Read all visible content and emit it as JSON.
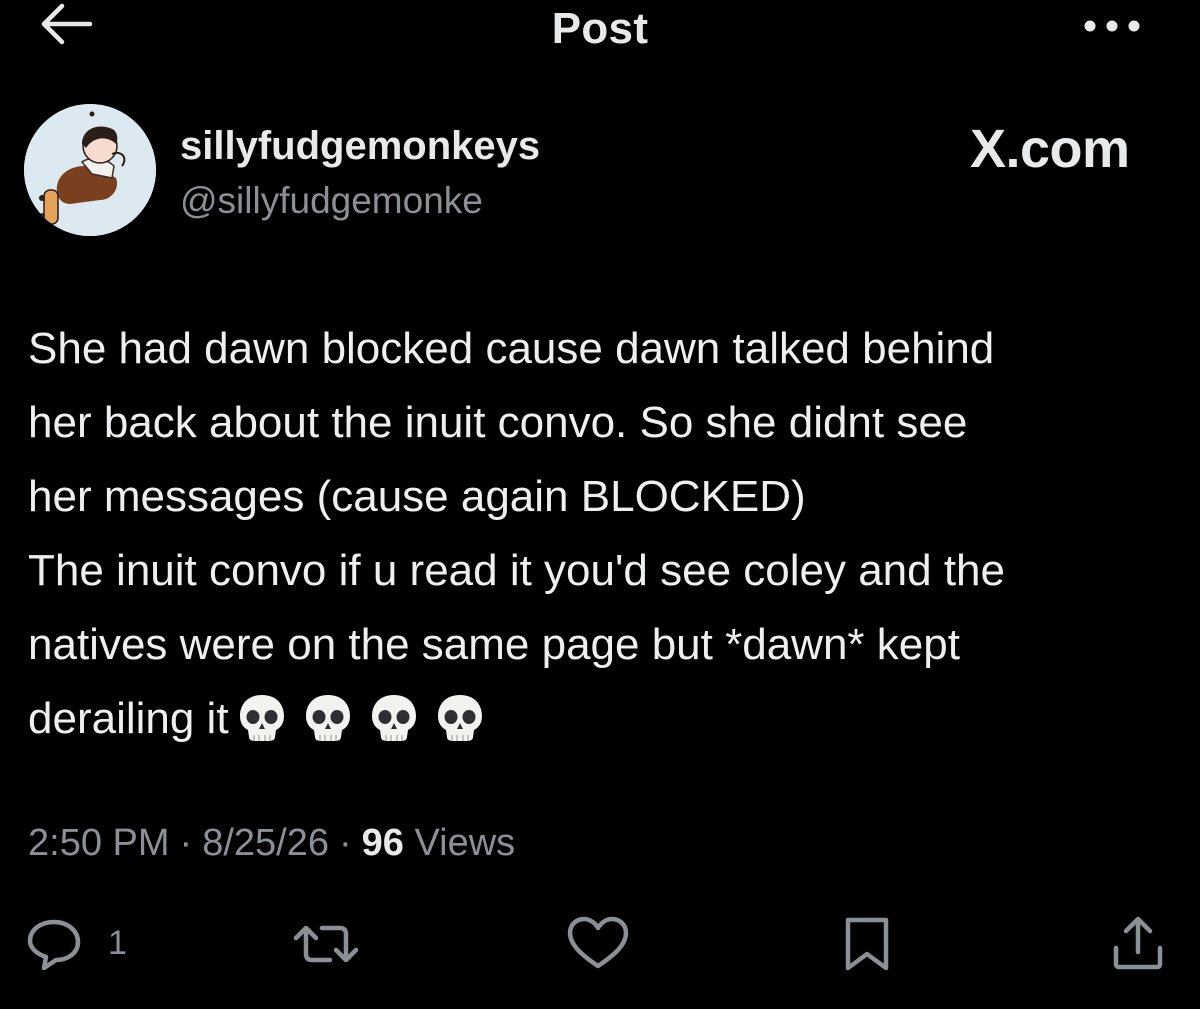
{
  "header": {
    "title": "Post",
    "back_icon": "arrow-left-icon",
    "more_icon": "more-horizontal-icon"
  },
  "author": {
    "display_name": "sillyfudgemonkeys",
    "handle": "@sillyfudgemonke",
    "avatar_icon": "cartoon-character-avatar"
  },
  "watermark": "X.com",
  "post": {
    "lines": [
      "She had dawn blocked cause dawn talked behind",
      "her back about the inuit convo. So she didnt see",
      "her messages (cause again BLOCKED)",
      "The inuit convo if u read it you'd see coley and the",
      "natives were on the same page but *dawn* kept",
      "derailing it"
    ],
    "emoji": [
      "skull-emoji",
      "skull-emoji",
      "skull-emoji",
      "skull-emoji"
    ]
  },
  "meta": {
    "time": "2:50 PM",
    "date": "8/25/26",
    "views_count": "96",
    "views_label": "Views",
    "separator": "·"
  },
  "actions": {
    "reply_icon": "reply-bubble-icon",
    "reply_count": "1",
    "repost_icon": "repost-icon",
    "like_icon": "heart-icon",
    "bookmark_icon": "bookmark-icon",
    "share_icon": "share-icon"
  },
  "colors": {
    "background": "#000000",
    "primary_text": "#e7e9ea",
    "secondary_text": "#8b9097",
    "icon": "#8b9097"
  }
}
